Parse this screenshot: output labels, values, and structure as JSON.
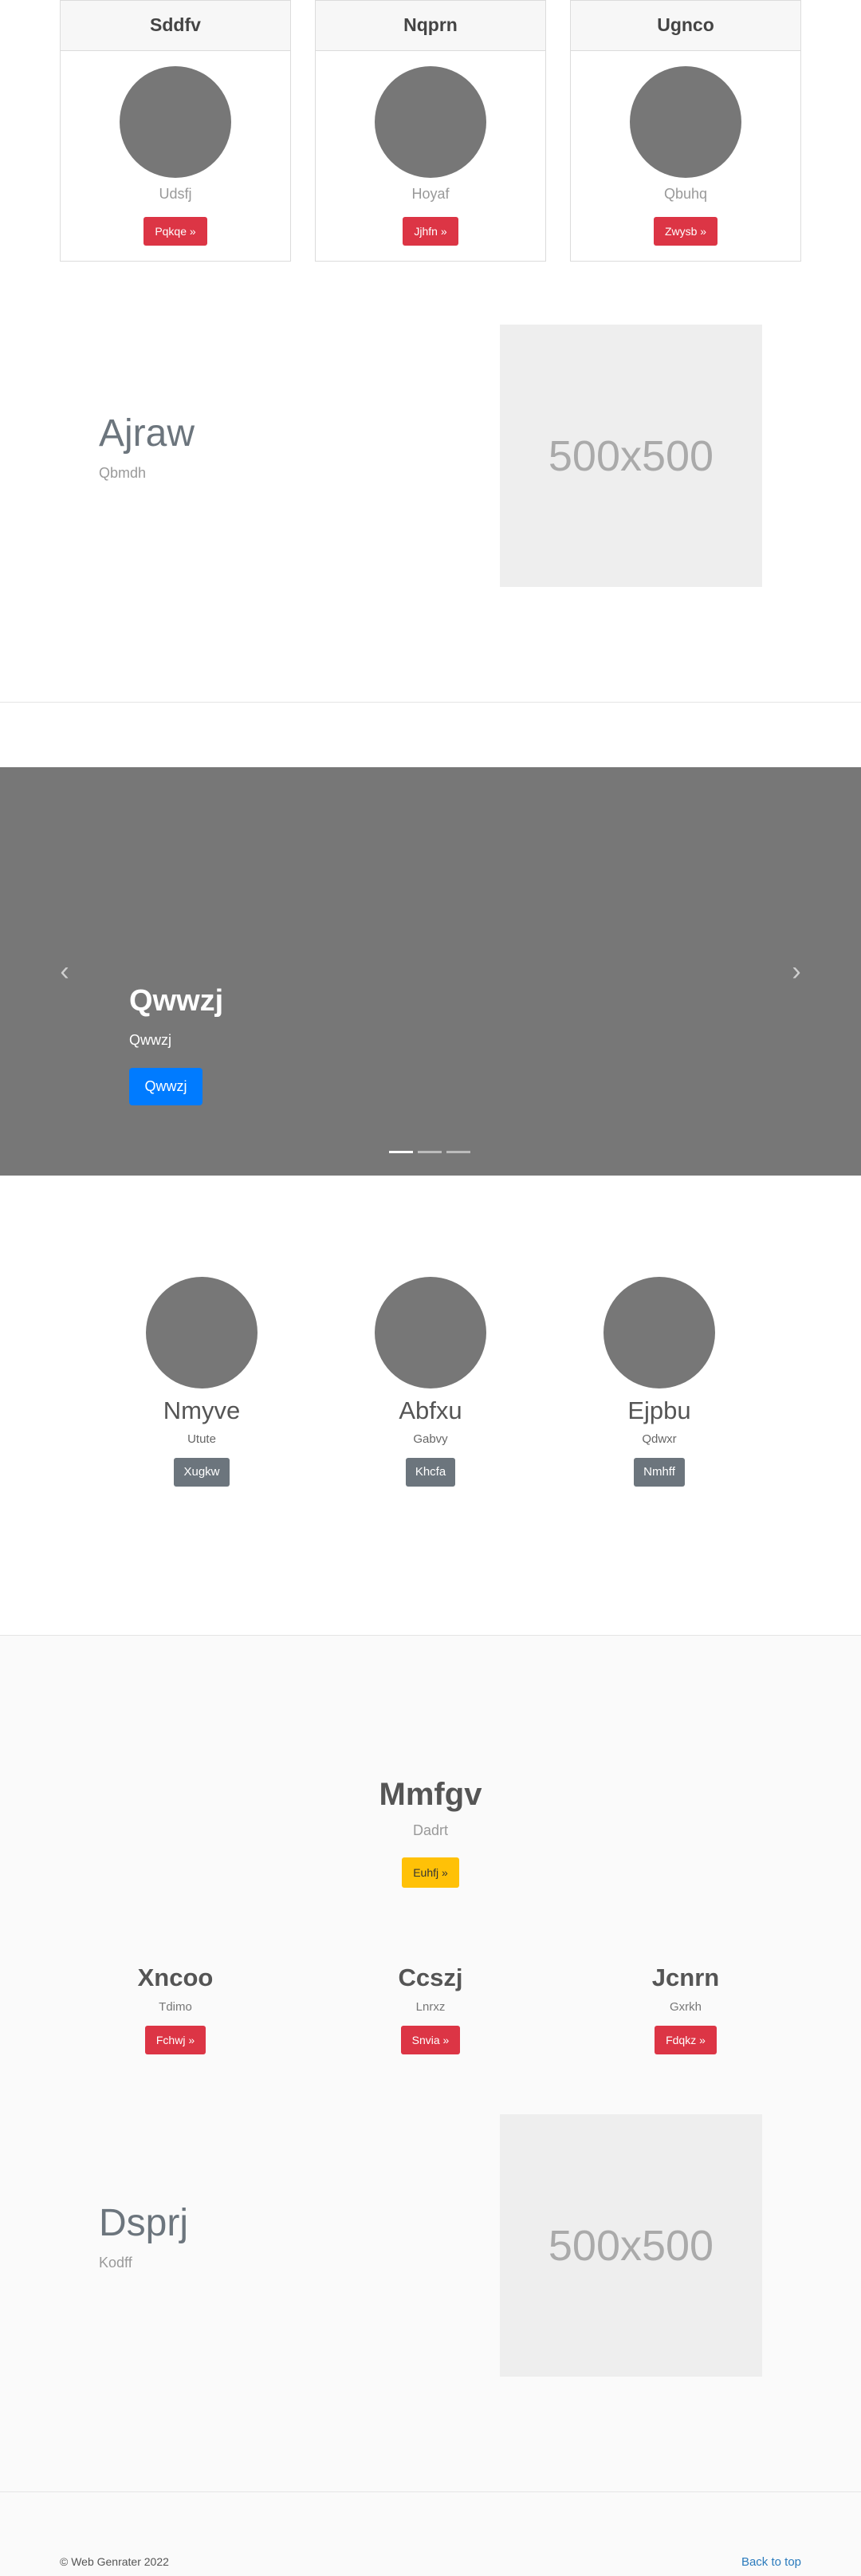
{
  "cards": [
    {
      "title": "Sddfv",
      "subtitle": "Udsfj",
      "button": "Pqkqe »"
    },
    {
      "title": "Nqprn",
      "subtitle": "Hoyaf",
      "button": "Jjhfn »"
    },
    {
      "title": "Ugnco",
      "subtitle": "Qbuhq",
      "button": "Zwysb »"
    }
  ],
  "feature1": {
    "title": "Ajraw",
    "subtitle": "Qbmdh",
    "image_label": "500x500"
  },
  "carousel": {
    "title": "Qwwzj",
    "subtitle": "Qwwzj",
    "button": "Qwwzj",
    "prev_icon": "‹",
    "next_icon": "›",
    "active_indicator": 0,
    "indicator_count": 3
  },
  "people": [
    {
      "name": "Nmyve",
      "subtitle": "Utute",
      "button": "Xugkw"
    },
    {
      "name": "Abfxu",
      "subtitle": "Gabvy",
      "button": "Khcfa"
    },
    {
      "name": "Ejpbu",
      "subtitle": "Qdwxr",
      "button": "Nmhff"
    }
  ],
  "hero": {
    "title": "Mmfgv",
    "subtitle": "Dadrt",
    "button": "Euhfj »"
  },
  "columns": [
    {
      "title": "Xncoo",
      "subtitle": "Tdimo",
      "button": "Fchwj »"
    },
    {
      "title": "Ccszj",
      "subtitle": "Lnrxz",
      "button": "Snvia »"
    },
    {
      "title": "Jcnrn",
      "subtitle": "Gxrkh",
      "button": "Fdqkz »"
    }
  ],
  "feature2": {
    "title": "Dsprj",
    "subtitle": "Kodff",
    "image_label": "500x500"
  },
  "footer": {
    "copyright": "© Web Genrater 2022",
    "back_to_top": "Back to top"
  },
  "colors": {
    "danger": "#dc3545",
    "primary": "#007bff",
    "warning": "#ffc107",
    "secondary": "#6c757d",
    "placeholder_grey": "#777777"
  }
}
